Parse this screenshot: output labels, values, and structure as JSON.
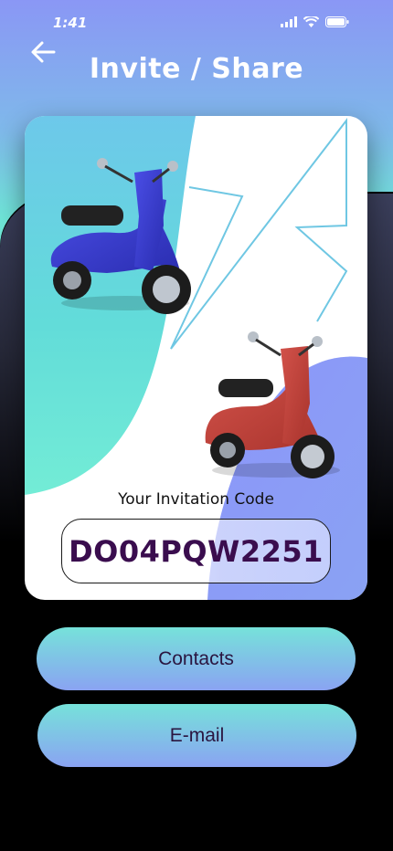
{
  "status_bar": {
    "time": "1:41"
  },
  "header": {
    "title": "Invite / Share"
  },
  "card": {
    "invitation_label": "Your Invitation Code",
    "invitation_code": "DO04PQW2251"
  },
  "actions": {
    "contacts_label": "Contacts",
    "email_label": "E-mail"
  },
  "colors": {
    "accent_teal": "#71ead9",
    "accent_blue": "#8a97f5",
    "code_text": "#3a0d4e"
  }
}
